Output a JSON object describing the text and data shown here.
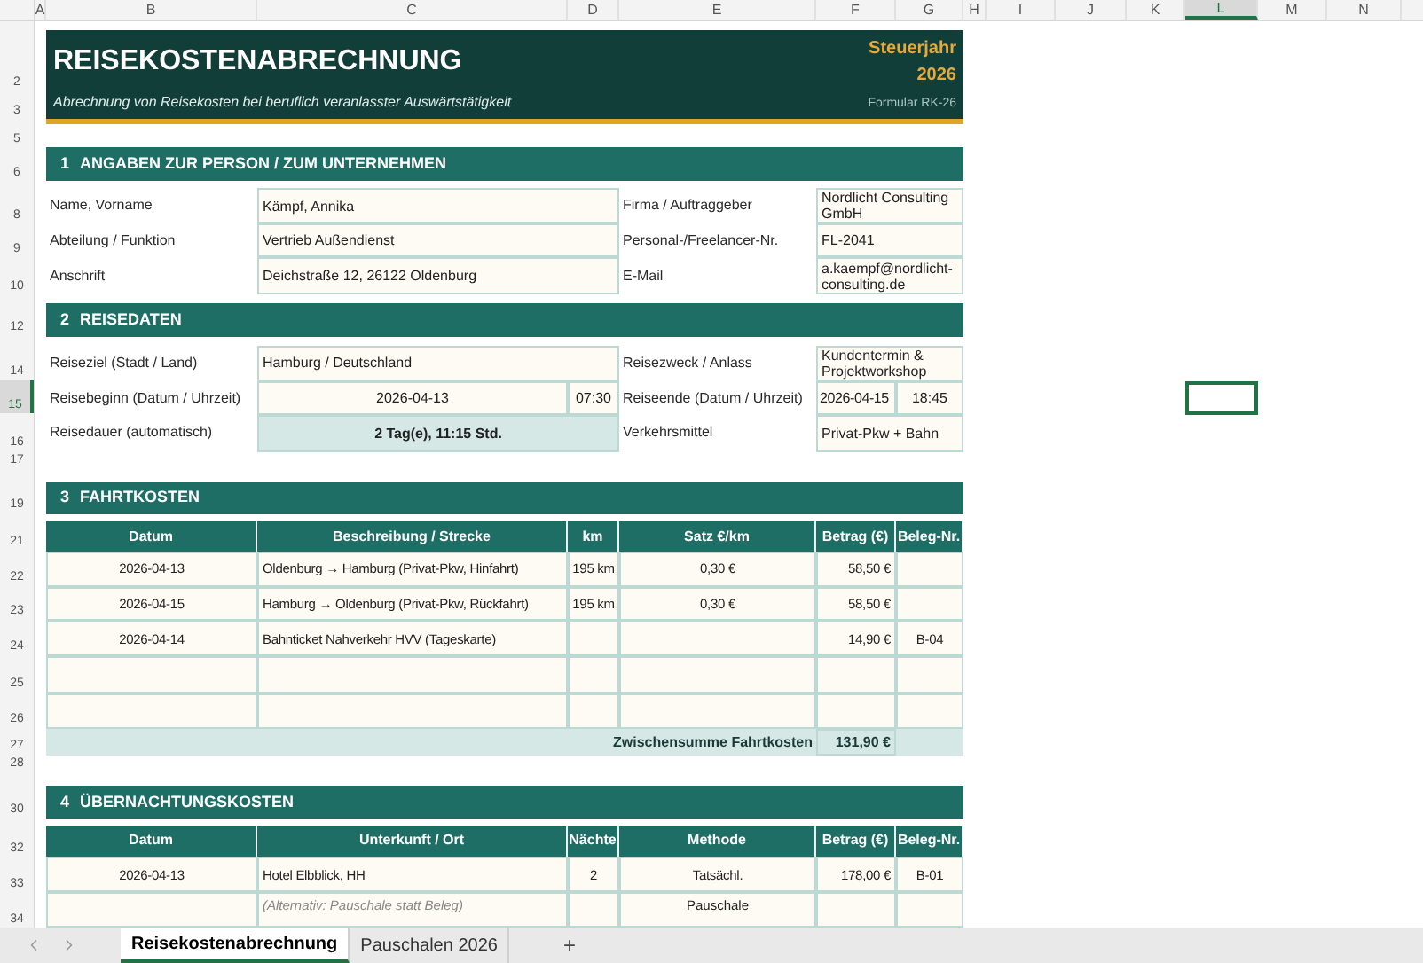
{
  "column_headers": [
    {
      "label": "A",
      "selected": false
    },
    {
      "label": "B",
      "selected": false
    },
    {
      "label": "C",
      "selected": false
    },
    {
      "label": "D",
      "selected": false
    },
    {
      "label": "E",
      "selected": false
    },
    {
      "label": "F",
      "selected": false
    },
    {
      "label": "G",
      "selected": false
    },
    {
      "label": "H",
      "selected": false
    },
    {
      "label": "I",
      "selected": false
    },
    {
      "label": "J",
      "selected": false
    },
    {
      "label": "K",
      "selected": false
    },
    {
      "label": "L",
      "selected": true
    },
    {
      "label": "M",
      "selected": false
    },
    {
      "label": "N",
      "selected": false
    }
  ],
  "row_headers": [
    {
      "label": "2",
      "selected": false
    },
    {
      "label": "3",
      "selected": false
    },
    {
      "label": "5",
      "selected": false
    },
    {
      "label": "6",
      "selected": false
    },
    {
      "label": "8",
      "selected": false
    },
    {
      "label": "9",
      "selected": false
    },
    {
      "label": "10",
      "selected": false
    },
    {
      "label": "12",
      "selected": false
    },
    {
      "label": "14",
      "selected": false
    },
    {
      "label": "15",
      "selected": true
    },
    {
      "label": "16",
      "selected": false
    },
    {
      "label": "17",
      "selected": false
    },
    {
      "label": "19",
      "selected": false
    },
    {
      "label": "21",
      "selected": false
    },
    {
      "label": "22",
      "selected": false
    },
    {
      "label": "23",
      "selected": false
    },
    {
      "label": "24",
      "selected": false
    },
    {
      "label": "25",
      "selected": false
    },
    {
      "label": "26",
      "selected": false
    },
    {
      "label": "27",
      "selected": false
    },
    {
      "label": "28",
      "selected": false
    },
    {
      "label": "30",
      "selected": false
    },
    {
      "label": "32",
      "selected": false
    },
    {
      "label": "33",
      "selected": false
    },
    {
      "label": "34",
      "selected": false
    }
  ],
  "banner": {
    "title": "REISEKOSTENABRECHNUNG",
    "subtitle": "Abrechnung von Reisekosten bei beruflich veranlasster Auswärtstätigkeit",
    "tax_year_label": "Steuerjahr",
    "tax_year": "2026",
    "form_number": "Formular RK-26"
  },
  "person": {
    "number": "1",
    "title": "ANGABEN ZUR PERSON / ZUM UNTERNEHMEN",
    "rows": [
      {
        "left_label": "Name, Vorname",
        "left_value": "Kämpf, Annika",
        "right_label": "Firma / Auftraggeber",
        "right_value": "Nordlicht Consulting GmbH"
      },
      {
        "left_label": "Abteilung / Funktion",
        "left_value": "Vertrieb Außendienst",
        "right_label": "Personal-/Freelancer-Nr.",
        "right_value": "FL-2041"
      },
      {
        "left_label": "Anschrift",
        "left_value": "Deichstraße 12, 26122 Oldenburg",
        "right_label": "E-Mail",
        "right_value": "a.kaempf@nordlicht-consulting.de"
      }
    ]
  },
  "trip": {
    "number": "2",
    "title": "REISEDATEN",
    "rows": [
      {
        "kind": "pair",
        "left_label": "Reiseziel (Stadt / Land)",
        "left_value": "Hamburg / Deutschland",
        "right_label": "Reisezweck / Anlass",
        "right_value": "Kundentermin & Projektworkshop"
      },
      {
        "kind": "datetime",
        "left_label": "Reisebeginn (Datum / Uhrzeit)",
        "left_date": "2026-04-13",
        "left_time": "07:30",
        "right_label": "Reiseende (Datum / Uhrzeit)",
        "right_date": "2026-04-15",
        "right_time": "18:45"
      },
      {
        "kind": "computed",
        "left_label": "Reisedauer (automatisch)",
        "left_value": "2 Tag(e), 11:15 Std.",
        "right_label": "Verkehrsmittel",
        "right_value": "Privat-Pkw + Bahn"
      }
    ]
  },
  "travel_costs": {
    "number": "3",
    "title": "FAHRTKOSTEN",
    "columns": [
      "Datum",
      "Beschreibung / Strecke",
      "km",
      "Satz €/km",
      "Betrag (€)",
      "Beleg-Nr."
    ],
    "rows": [
      [
        "2026-04-13",
        "Oldenburg → Hamburg (Privat-Pkw, Hinfahrt)",
        "195 km",
        "0,30 €",
        "58,50 €",
        ""
      ],
      [
        "2026-04-15",
        "Hamburg → Oldenburg (Privat-Pkw, Rückfahrt)",
        "195 km",
        "0,30 €",
        "58,50 €",
        ""
      ],
      [
        "2026-04-14",
        "Bahnticket Nahverkehr HVV (Tageskarte)",
        "",
        "",
        "14,90 €",
        "B-04"
      ]
    ],
    "subtotal_label": "Zwischensumme Fahrtkosten",
    "subtotal_value": "131,90 €"
  },
  "lodging": {
    "number": "4",
    "title": "ÜBERNACHTUNGSKOSTEN",
    "columns": [
      "Datum",
      "Unterkunft / Ort",
      "Nächte",
      "Methode",
      "Betrag (€)",
      "Beleg-Nr."
    ],
    "rows": [
      {
        "kind": "entry",
        "date": "2026-04-13",
        "place": "Hotel Elbblick, HH",
        "nights": "2",
        "method": "Tatsächl.",
        "amount": "178,00 €",
        "receipt": "B-01"
      },
      {
        "kind": "note",
        "place": "(Alternativ: Pauschale statt Beleg)",
        "method": "Pauschale"
      }
    ]
  },
  "sheet_tabs": [
    {
      "label": "Reisekostenabrechnung",
      "selected": true
    },
    {
      "label": "Pauschalen 2026",
      "selected": false
    }
  ],
  "add_sheet": "+"
}
